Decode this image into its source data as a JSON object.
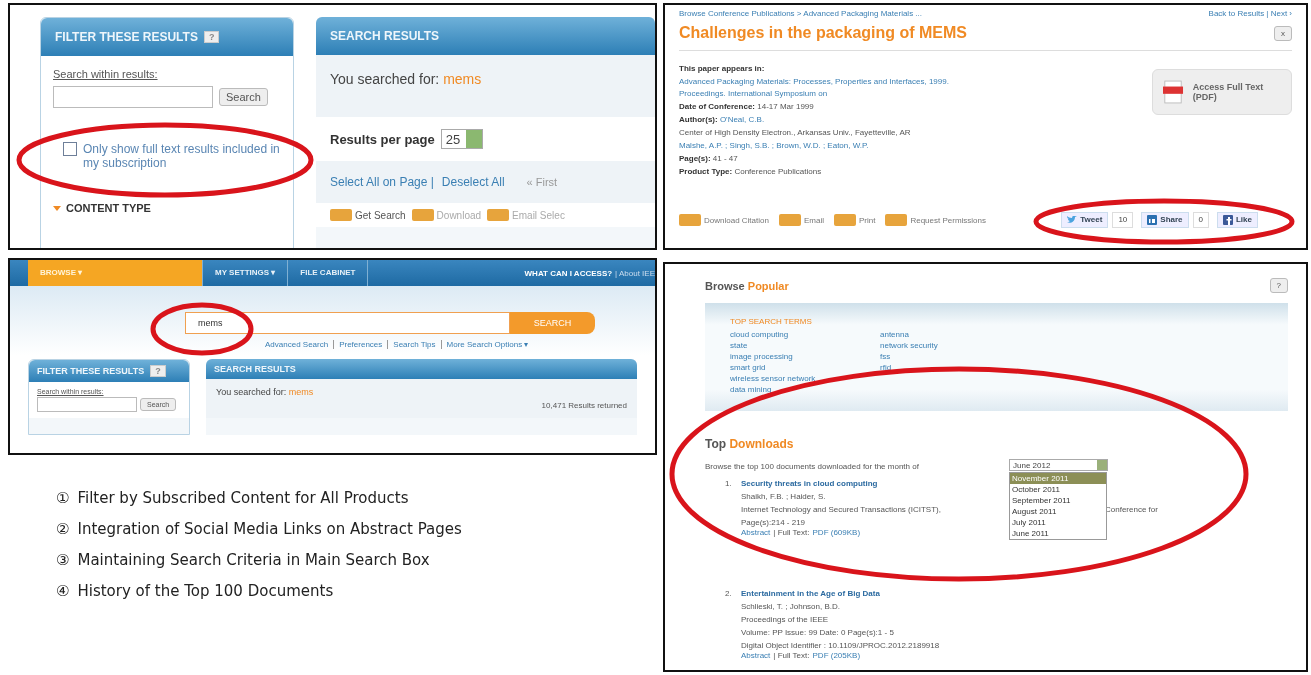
{
  "filter_panel": {
    "filter_title": "FILTER THESE RESULTS",
    "help": "?",
    "search_label": "Search within results:",
    "search_button": "Search",
    "fulltext_option": {
      "label": "Only show full text results included in my subscription",
      "checked": false
    },
    "content_type": "CONTENT TYPE",
    "results_title": "SEARCH RESULTS",
    "searched_label": "You searched for:",
    "query": "mems",
    "per_page_label": "Results per page",
    "per_page": "25",
    "select_all": "Select All on Page |",
    "deselect_all": "Deselect All",
    "first": "« First",
    "actions": [
      "Get Search",
      "Download",
      "Email Selec"
    ]
  },
  "abstract_panel": {
    "breadcrumb": "Browse Conference Publications > Advanced Packaging Materials ...",
    "back": "Back to Results | Next ›",
    "title": "Challenges in the packaging of MEMS",
    "close": "x",
    "meta": [
      {
        "label": "This paper appears in:"
      },
      {
        "value": "Advanced Packaging Materials: Processes, Properties and Interfaces, 1999. Proceedings. International Symposium on",
        "link": true
      },
      {
        "label": "Date of Conference:",
        "value": "14-17 Mar 1999",
        "link": false
      },
      {
        "label": "Author(s):",
        "value": "O'Neal, C.B.",
        "link": true
      },
      {
        "value": "Center of High Density Electron., Arkansas Univ., Fayetteville, AR",
        "link": false
      },
      {
        "value": "Malshe, A.P. ; Singh, S.B. ; Brown, W.D. ; Eaton, W.P.",
        "link": true
      },
      {
        "label": "Page(s):",
        "value": "41 - 47",
        "link": false
      },
      {
        "label": "Product Type:",
        "value": "Conference Publications",
        "link": false
      }
    ],
    "access_button": "Access Full Text (PDF)",
    "actions": [
      "Download Citation",
      "Email",
      "Print",
      "Request Permissions"
    ],
    "social": [
      {
        "kind": "tweet",
        "label": "Tweet",
        "count": "10"
      },
      {
        "kind": "share",
        "label": "Share",
        "count": "0"
      },
      {
        "kind": "like",
        "label": "Like"
      }
    ]
  },
  "search_panel": {
    "nav": [
      {
        "label": "BROWSE ▾",
        "selected": true
      },
      {
        "label": "MY SETTINGS ▾",
        "selected": false
      },
      {
        "label": "FILE CABINET",
        "selected": false
      }
    ],
    "access": "WHAT CAN I ACCESS?",
    "about": "| About IEE",
    "query": "mems",
    "search_button": "SEARCH",
    "links": [
      "Advanced Search",
      "Preferences",
      "Search Tips",
      "More Search Options ▾"
    ],
    "filter_title": "FILTER THESE RESULTS",
    "help": "?",
    "search_label": "Search within results:",
    "filter_button": "Search",
    "results_title": "SEARCH RESULTS",
    "searched_label": "You searched for:",
    "results_query": "mems",
    "result_count": "10,471 Results returned"
  },
  "popular_panel": {
    "title_dark": "Browse",
    "title_accent": "Popular",
    "help": "?",
    "terms_title": "TOP SEARCH TERMS",
    "terms_left": [
      "cloud computing",
      "state",
      "image processing",
      "smart grid",
      "wireless sensor network",
      "data mining"
    ],
    "terms_right": [
      "antenna",
      "network security",
      "fss",
      "rfid"
    ],
    "downloads_dark": "Top",
    "downloads_accent": "Downloads",
    "month_label": "Browse the top 100 documents downloaded for the month of",
    "month": "June 2012",
    "months": [
      {
        "label": "November 2011",
        "selected": true
      },
      {
        "label": "October 2011",
        "selected": false
      },
      {
        "label": "September 2011",
        "selected": false
      },
      {
        "label": "August 2011",
        "selected": false
      },
      {
        "label": "July 2011",
        "selected": false
      },
      {
        "label": "June 2011",
        "selected": false
      }
    ],
    "documents": [
      {
        "number": "1.",
        "title": "Security threats in cloud computing",
        "lines": [
          [
            "Shaikh, F.B. ; Haider, S."
          ],
          [
            "Internet Technology and Secured Transactions (ICITST),",
            "Conference for"
          ],
          [
            "Page(s):214 - 219"
          ]
        ],
        "abstract": "Abstract",
        "full_text": "| Full Text:",
        "pdf": "PDF (609KB)"
      },
      {
        "number": "2.",
        "title": "Entertainment in the Age of Big Data",
        "lines": [
          [
            "Schlieski, T. ; Johnson, B.D."
          ],
          [
            "Proceedings of the IEEE"
          ],
          [
            "Volume: PP Issue: 99 Date: 0 Page(s):1 - 5"
          ],
          [
            "Digital Object Identifier : 10.1109/JPROC.2012.2189918"
          ]
        ],
        "abstract": "Abstract",
        "full_text": "| Full Text:",
        "pdf": "PDF (205KB)"
      }
    ]
  },
  "captions": [
    {
      "number": "①",
      "text": "Filter by Subscribed Content for All Products"
    },
    {
      "number": "②",
      "text": "Integration of Social Media Links on Abstract Pages"
    },
    {
      "number": "③",
      "text": "Maintaining Search Criteria in Main Search Box"
    },
    {
      "number": "④",
      "text": "History of the Top 100 Documents"
    }
  ]
}
